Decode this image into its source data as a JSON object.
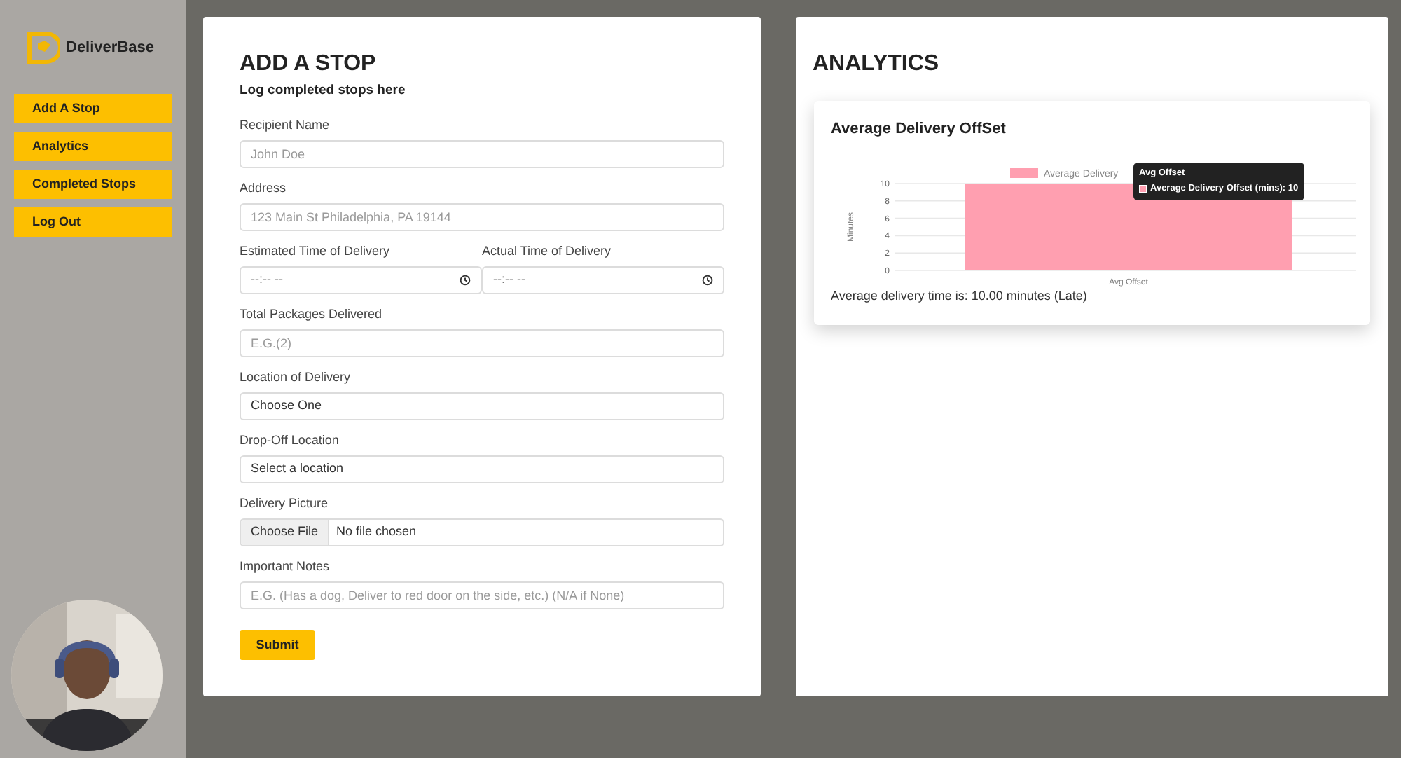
{
  "brand": {
    "name": "DeliverBase"
  },
  "sidebar": {
    "items": [
      {
        "label": "Add A Stop"
      },
      {
        "label": "Analytics"
      },
      {
        "label": "Completed Stops"
      },
      {
        "label": "Log Out"
      }
    ]
  },
  "form": {
    "title": "ADD A STOP",
    "subtitle": "Log completed stops here",
    "fields": [
      {
        "kind": "text",
        "label": "Recipient Name",
        "placeholder": "John Doe"
      },
      {
        "kind": "text",
        "label": "Address",
        "placeholder": "123 Main St Philadelphia, PA 19144"
      },
      {
        "kind": "time",
        "label": "Estimated Time of Delivery",
        "placeholder": "--:-- --"
      },
      {
        "kind": "time",
        "label": "Actual Time of Delivery",
        "placeholder": "--:-- --"
      },
      {
        "kind": "text",
        "label": "Total Packages Delivered",
        "placeholder": "E.G.(2)"
      },
      {
        "kind": "select",
        "label": "Location of Delivery",
        "value": "Choose One"
      },
      {
        "kind": "select",
        "label": "Drop-Off Location",
        "value": "Select a location"
      },
      {
        "kind": "file",
        "label": "Delivery Picture",
        "button": "Choose File",
        "value": "No file chosen"
      },
      {
        "kind": "text",
        "label": "Important Notes",
        "placeholder": "E.G. (Has a dog, Deliver to red door on the side, etc.) (N/A if None)"
      }
    ],
    "submit": "Submit"
  },
  "analytics": {
    "title": "ANALYTICS",
    "card": {
      "title": "Average Delivery OffSet",
      "chart_data": {
        "type": "bar",
        "ylabel": "Minutes",
        "categories": [
          "Avg Offset"
        ],
        "series": [
          {
            "name": "Average Delivery",
            "color": "#ff9fb0",
            "values": [
              10
            ]
          }
        ],
        "grid": true,
        "ylim": [
          0,
          10
        ],
        "yticks": [
          0,
          2,
          4,
          6,
          8,
          10
        ]
      },
      "tooltip": {
        "title": "Avg Offset",
        "body": "Average Delivery Offset (mins): 10"
      },
      "summary": "Average delivery time is: 10.00 minutes (Late)"
    }
  }
}
